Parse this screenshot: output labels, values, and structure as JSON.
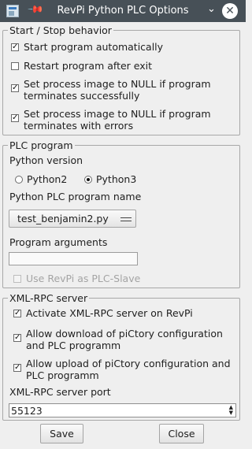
{
  "window": {
    "title": "RevPi Python PLC Options",
    "pin_glyph": "📌",
    "chevron_glyph": "⌄",
    "close_glyph": "✕"
  },
  "start_stop": {
    "legend": "Start / Stop behavior",
    "items": [
      {
        "label": "Start program automatically",
        "checked": true
      },
      {
        "label": "Restart program after exit",
        "checked": false
      },
      {
        "label": "Set process image to NULL if program terminates successfully",
        "checked": true
      },
      {
        "label": "Set process image to NULL if program terminates with errors",
        "checked": true
      }
    ]
  },
  "plc_program": {
    "legend": "PLC program",
    "python_version_label": "Python version",
    "python2_label": "Python2",
    "python3_label": "Python3",
    "selected_version": "Python3",
    "program_name_label": "Python PLC program name",
    "program_name_value": "test_benjamin2.py",
    "arguments_label": "Program arguments",
    "arguments_value": "",
    "slave_label": "Use RevPi as PLC-Slave",
    "slave_checked": false,
    "slave_enabled": false
  },
  "xmlrpc": {
    "legend": "XML-RPC server",
    "items": [
      {
        "label": "Activate XML-RPC server on RevPi",
        "checked": true
      },
      {
        "label": "Allow download of piCtory configuration and PLC programm",
        "checked": true
      },
      {
        "label": "Allow upload of piCtory configuration and PLC programm",
        "checked": true
      }
    ],
    "port_label": "XML-RPC server port",
    "port_value": "55123"
  },
  "buttons": {
    "save": "Save",
    "close": "Close"
  },
  "check_glyph": "✓",
  "spin_up_glyph": "▲",
  "spin_down_glyph": "▼"
}
